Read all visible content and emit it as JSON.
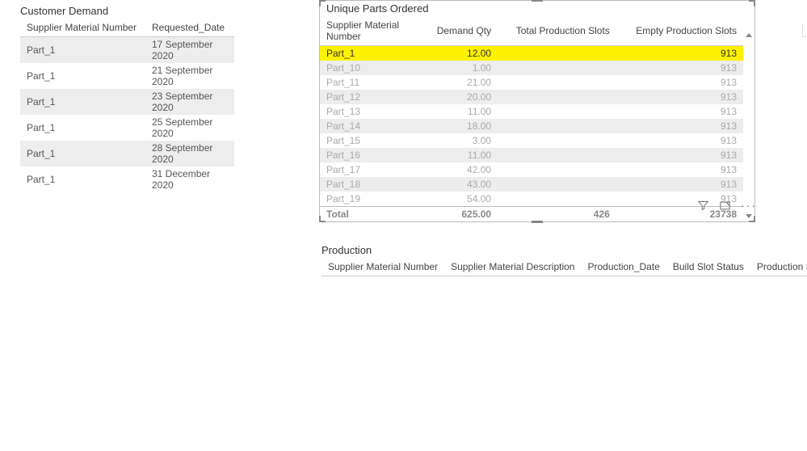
{
  "customer_demand": {
    "title": "Customer Demand",
    "headers": [
      "Supplier Material Number",
      "Requested_Date"
    ],
    "rows": [
      {
        "material": "Part_1",
        "date": "17 September 2020"
      },
      {
        "material": "Part_1",
        "date": "21 September 2020"
      },
      {
        "material": "Part_1",
        "date": "23 September 2020"
      },
      {
        "material": "Part_1",
        "date": "25 September 2020"
      },
      {
        "material": "Part_1",
        "date": "28 September 2020"
      },
      {
        "material": "Part_1",
        "date": "31 December 2020"
      }
    ]
  },
  "unique_parts": {
    "title": "Unique Parts Ordered",
    "headers": [
      "Supplier Material Number",
      "Demand Qty",
      "Total Production Slots",
      "Empty Production Slots"
    ],
    "rows": [
      {
        "material": "Part_1",
        "qty": "12.00",
        "total": "",
        "empty": "913",
        "highlight": true
      },
      {
        "material": "Part_10",
        "qty": "1.00",
        "total": "",
        "empty": "913"
      },
      {
        "material": "Part_11",
        "qty": "21.00",
        "total": "",
        "empty": "913"
      },
      {
        "material": "Part_12",
        "qty": "20.00",
        "total": "",
        "empty": "913"
      },
      {
        "material": "Part_13",
        "qty": "11.00",
        "total": "",
        "empty": "913"
      },
      {
        "material": "Part_14",
        "qty": "18.00",
        "total": "",
        "empty": "913"
      },
      {
        "material": "Part_15",
        "qty": "3.00",
        "total": "",
        "empty": "913"
      },
      {
        "material": "Part_16",
        "qty": "11.00",
        "total": "",
        "empty": "913"
      },
      {
        "material": "Part_17",
        "qty": "42.00",
        "total": "",
        "empty": "913"
      },
      {
        "material": "Part_18",
        "qty": "43.00",
        "total": "",
        "empty": "913"
      },
      {
        "material": "Part_19",
        "qty": "54.00",
        "total": "",
        "empty": "913"
      }
    ],
    "total": {
      "label": "Total",
      "qty": "625.00",
      "total": "426",
      "empty": "23738"
    }
  },
  "production": {
    "title": "Production",
    "headers": [
      "Supplier Material Number",
      "Supplier Material Description",
      "Production_Date",
      "Build Slot Status",
      "Production Slot Number"
    ]
  }
}
